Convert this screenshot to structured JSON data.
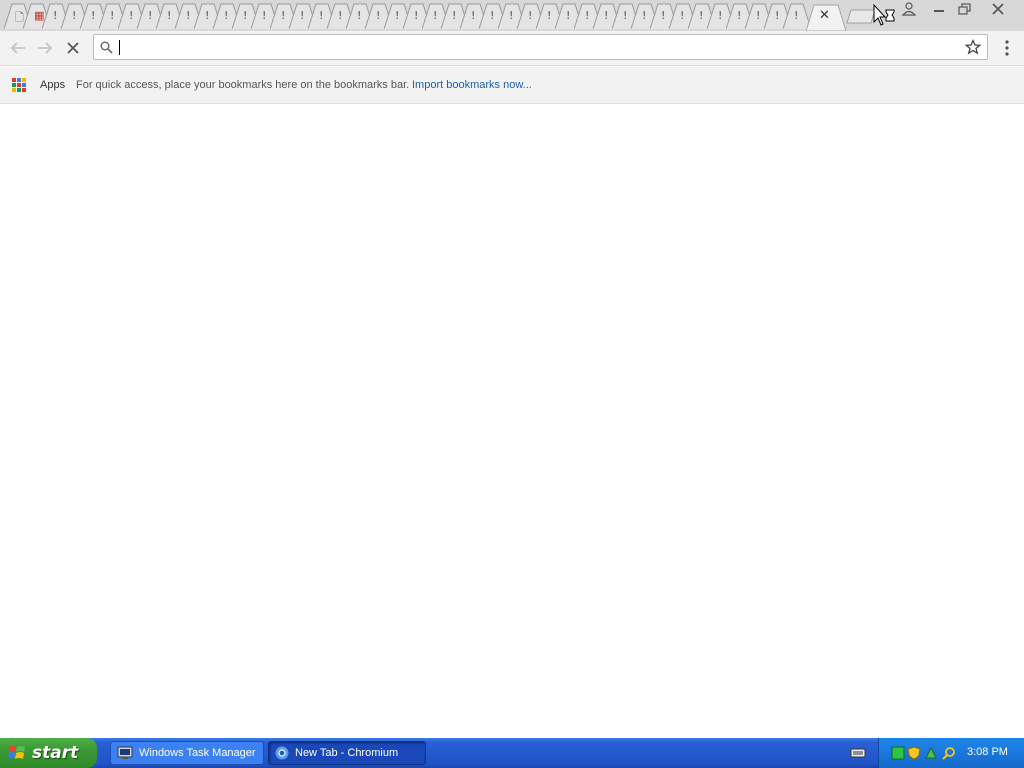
{
  "browser": {
    "tab_count_inactive": 42,
    "omnibox_value": "",
    "bookmarks_bar": {
      "apps_label": "Apps",
      "hint_text": "For quick access, place your bookmarks here on the bookmarks bar.",
      "import_link": "Import bookmarks now..."
    }
  },
  "taskbar": {
    "start_label": "start",
    "tasks": [
      {
        "label": "Windows Task Manager"
      },
      {
        "label": "New Tab - Chromium"
      }
    ],
    "clock": "3:08 PM"
  },
  "colors": {
    "taskbar_blue": "#245ad0",
    "start_green": "#3c9a34",
    "tray_blue": "#1a78dc",
    "link_blue": "#1a5fb4"
  }
}
